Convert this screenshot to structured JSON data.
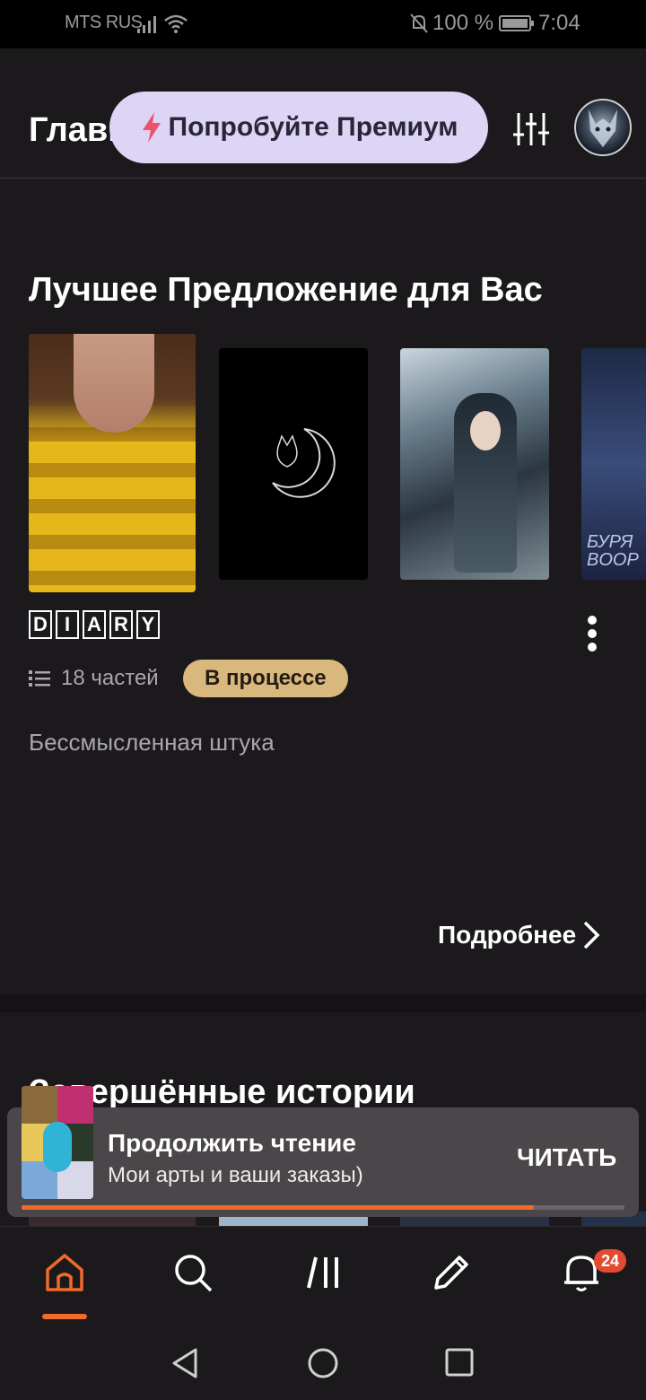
{
  "status_bar": {
    "carrier": "MTS RUS",
    "battery": "100 %",
    "time": "7:04"
  },
  "header": {
    "title": "Главная",
    "premium_label": "Попробуйте Премиум",
    "accent_color": "#dcd5f6"
  },
  "recommended": {
    "title": "Лучшее Предложение для Вас",
    "covers": [
      {
        "name": "diary-cover"
      },
      {
        "name": "moon-cat-cover"
      },
      {
        "name": "anime-cover"
      },
      {
        "name": "storm-cover",
        "text_line1": "БУРЯ",
        "text_line2": "BOOP"
      }
    ],
    "selected_story": {
      "title_letters": [
        "D",
        "I",
        "A",
        "R",
        "Y"
      ],
      "parts": "18 частей",
      "status": "В процессе",
      "description": "Бессмысленная штука",
      "details_link": "Подробнее"
    }
  },
  "completed": {
    "title": "Завершённые истории"
  },
  "continue_reading": {
    "label": "Продолжить чтение",
    "story": "Мои арты и ваши заказы)",
    "action": "ЧИТАТЬ",
    "progress": 0.85
  },
  "bottom_nav": {
    "items": [
      "home",
      "search",
      "library",
      "write",
      "notifications"
    ],
    "active": "home",
    "notifications_count": "24",
    "accent_color": "#f06a2a"
  }
}
